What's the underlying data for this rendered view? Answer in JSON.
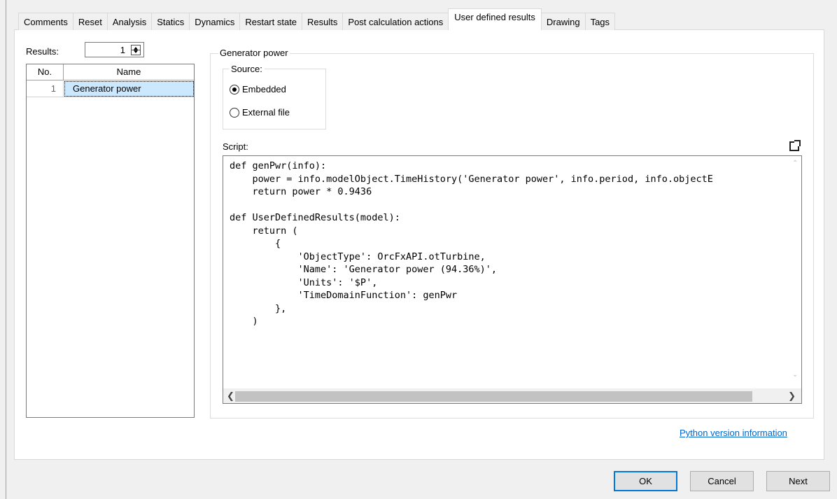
{
  "tabs": [
    {
      "label": "Comments"
    },
    {
      "label": "Reset"
    },
    {
      "label": "Analysis"
    },
    {
      "label": "Statics"
    },
    {
      "label": "Dynamics"
    },
    {
      "label": "Restart state"
    },
    {
      "label": "Results"
    },
    {
      "label": "Post calculation actions"
    },
    {
      "label": "User defined results",
      "active": true
    },
    {
      "label": "Drawing"
    },
    {
      "label": "Tags"
    }
  ],
  "results": {
    "label": "Results:",
    "count": "1",
    "columns": {
      "no": "No.",
      "name": "Name"
    },
    "rows": [
      {
        "no": "1",
        "name": "Generator power"
      }
    ]
  },
  "detail": {
    "group_title": "Generator power",
    "source_label": "Source:",
    "options": [
      {
        "label": "Embedded",
        "checked": true
      },
      {
        "label": "External file",
        "checked": false
      }
    ],
    "script_label": "Script:",
    "script": "def genPwr(info):\n    power = info.modelObject.TimeHistory('Generator power', info.period, info.objectE\n    return power * 0.9436\n\ndef UserDefinedResults(model):\n    return (\n        {\n            'ObjectType': OrcFxAPI.otTurbine,\n            'Name': 'Generator power (94.36%)',\n            'Units': '$P',\n            'TimeDomainFunction': genPwr\n        },\n    )",
    "link": "Python version information"
  },
  "buttons": {
    "ok": "OK",
    "cancel": "Cancel",
    "next": "Next"
  }
}
